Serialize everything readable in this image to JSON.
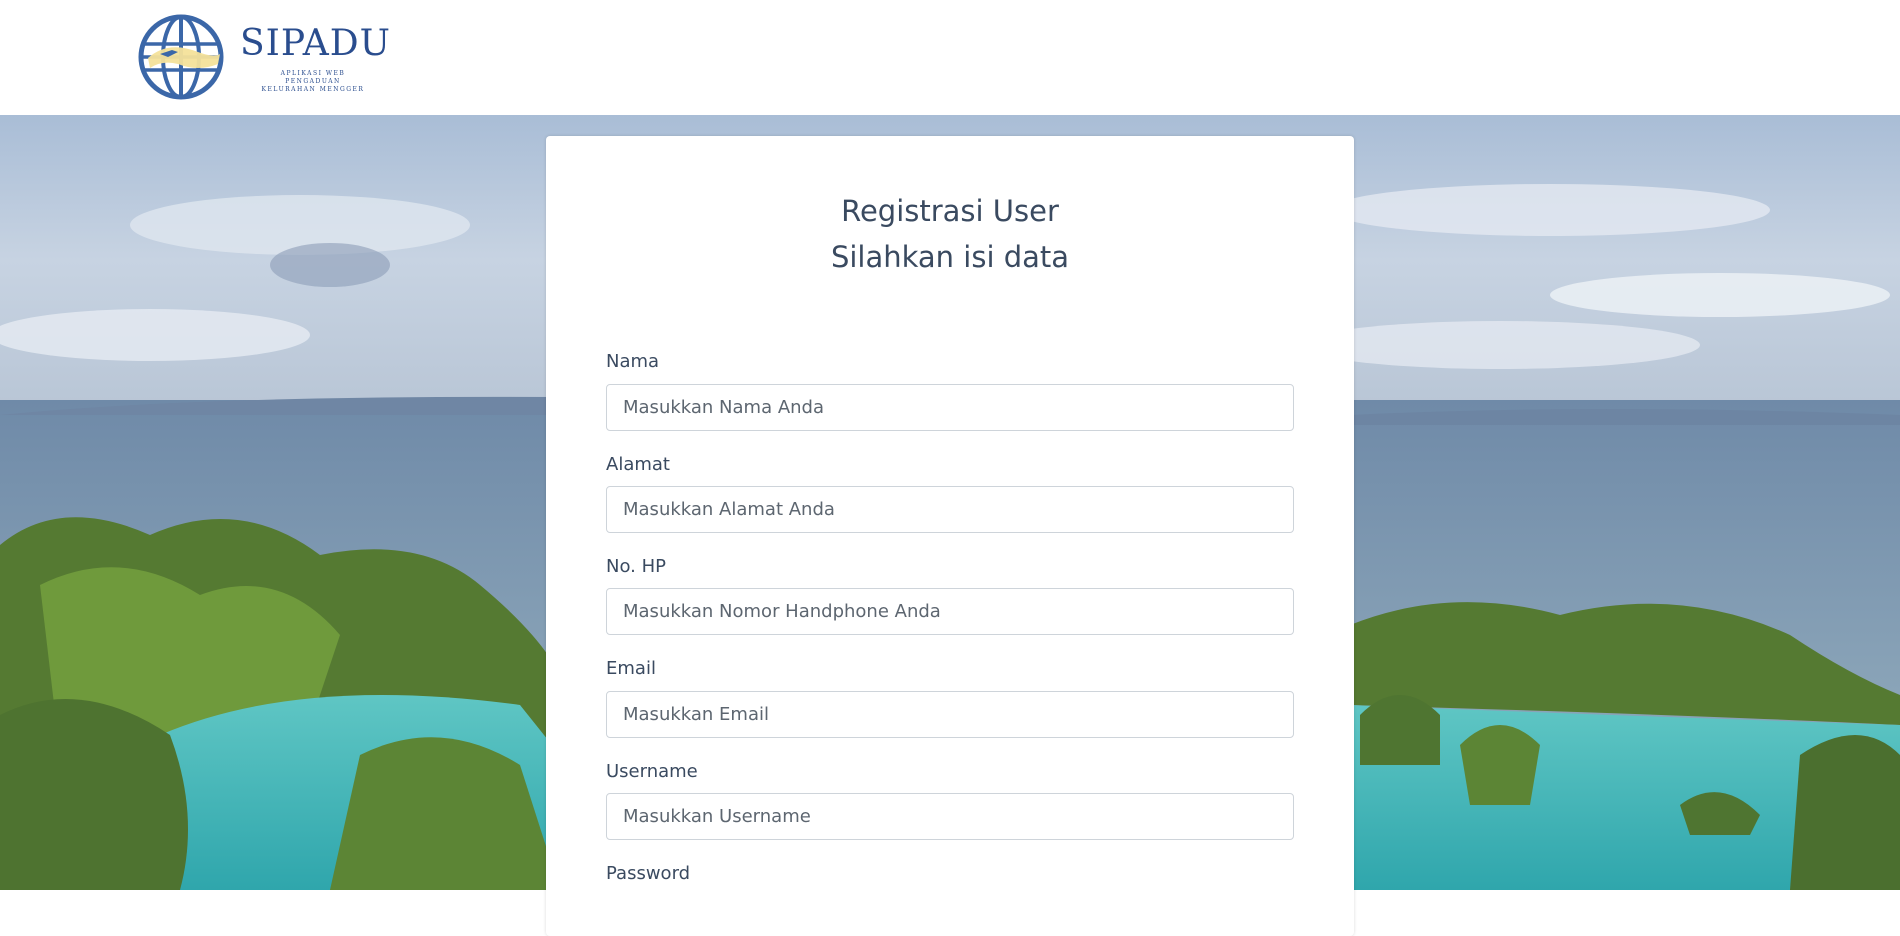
{
  "header": {
    "app_name": "SIPADU",
    "tagline_lines": [
      "APLIKASI WEB",
      "PENGADUAN",
      "KELURAHAN MENGGER"
    ]
  },
  "card": {
    "title": "Registrasi User",
    "subtitle": "Silahkan isi data"
  },
  "form": {
    "fields": [
      {
        "label": "Nama",
        "placeholder": "Masukkan Nama Anda",
        "value": ""
      },
      {
        "label": "Alamat",
        "placeholder": "Masukkan Alamat Anda",
        "value": ""
      },
      {
        "label": "No. HP",
        "placeholder": "Masukkan Nomor Handphone Anda",
        "value": ""
      },
      {
        "label": "Email",
        "placeholder": "Masukkan Email",
        "value": ""
      },
      {
        "label": "Username",
        "placeholder": "Masukkan Username",
        "value": ""
      },
      {
        "label": "Password",
        "placeholder": "",
        "value": ""
      }
    ]
  },
  "colors": {
    "brand": "#2a4d8e",
    "text": "#3a4a60",
    "input_border": "#ced4da"
  }
}
